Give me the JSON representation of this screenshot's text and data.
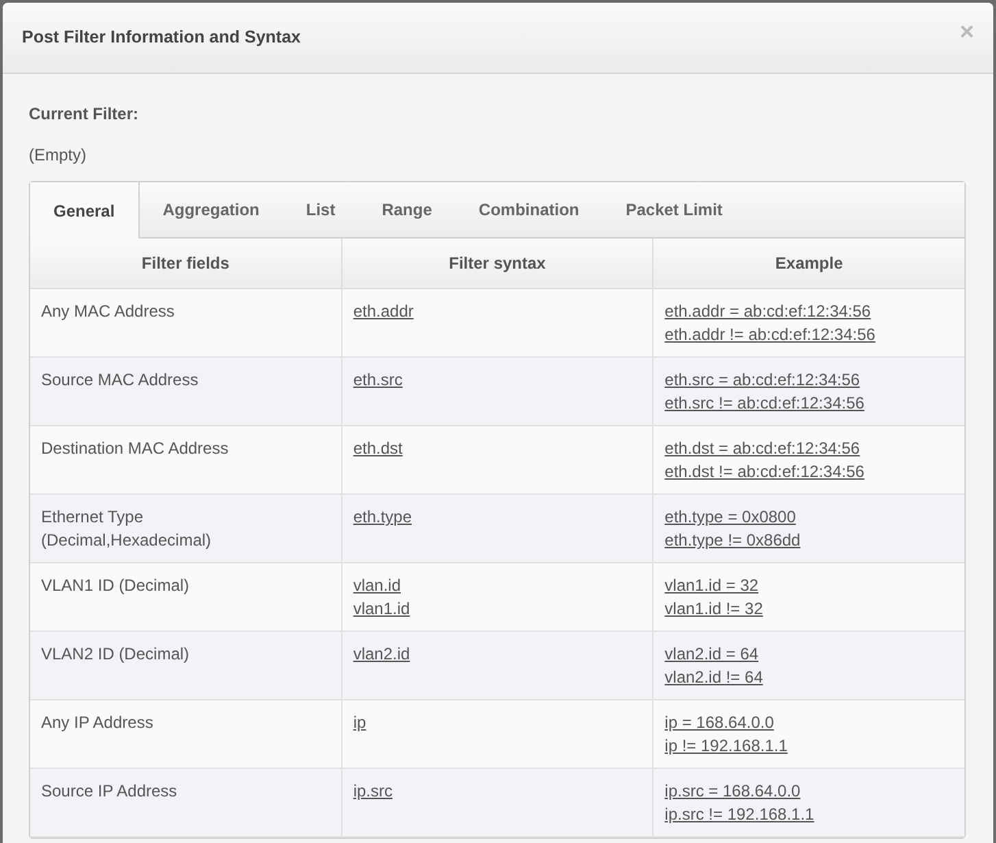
{
  "dialog": {
    "title": "Post Filter Information and Syntax",
    "close": "×"
  },
  "current_filter": {
    "label": "Current Filter:",
    "value": "(Empty)"
  },
  "tabs": [
    {
      "label": "General",
      "selected": true
    },
    {
      "label": "Aggregation",
      "selected": false
    },
    {
      "label": "List",
      "selected": false
    },
    {
      "label": "Range",
      "selected": false
    },
    {
      "label": "Combination",
      "selected": false
    },
    {
      "label": "Packet Limit",
      "selected": false
    }
  ],
  "table": {
    "columns": [
      "Filter fields",
      "Filter syntax",
      "Example"
    ],
    "rows": [
      {
        "field": [
          "Any MAC Address"
        ],
        "syntax": [
          "eth.addr"
        ],
        "example": [
          "eth.addr = ab:cd:ef:12:34:56",
          "eth.addr != ab:cd:ef:12:34:56"
        ]
      },
      {
        "field": [
          "Source MAC Address"
        ],
        "syntax": [
          "eth.src"
        ],
        "example": [
          "eth.src = ab:cd:ef:12:34:56",
          "eth.src != ab:cd:ef:12:34:56"
        ]
      },
      {
        "field": [
          "Destination MAC Address"
        ],
        "syntax": [
          "eth.dst"
        ],
        "example": [
          "eth.dst = ab:cd:ef:12:34:56",
          "eth.dst != ab:cd:ef:12:34:56"
        ]
      },
      {
        "field": [
          "Ethernet Type",
          "(Decimal,Hexadecimal)"
        ],
        "syntax": [
          "eth.type"
        ],
        "example": [
          "eth.type = 0x0800",
          "eth.type != 0x86dd"
        ]
      },
      {
        "field": [
          "VLAN1 ID (Decimal)"
        ],
        "syntax": [
          "vlan.id",
          "vlan1.id"
        ],
        "example": [
          "vlan1.id = 32",
          "vlan1.id != 32"
        ]
      },
      {
        "field": [
          "VLAN2 ID (Decimal)"
        ],
        "syntax": [
          "vlan2.id"
        ],
        "example": [
          "vlan2.id = 64",
          "vlan2.id != 64"
        ]
      },
      {
        "field": [
          "Any IP Address"
        ],
        "syntax": [
          "ip"
        ],
        "example": [
          "ip = 168.64.0.0",
          "ip != 192.168.1.1"
        ]
      },
      {
        "field": [
          "Source IP Address"
        ],
        "syntax": [
          "ip.src"
        ],
        "example": [
          "ip.src = 168.64.0.0",
          "ip.src != 192.168.1.1"
        ]
      }
    ]
  }
}
